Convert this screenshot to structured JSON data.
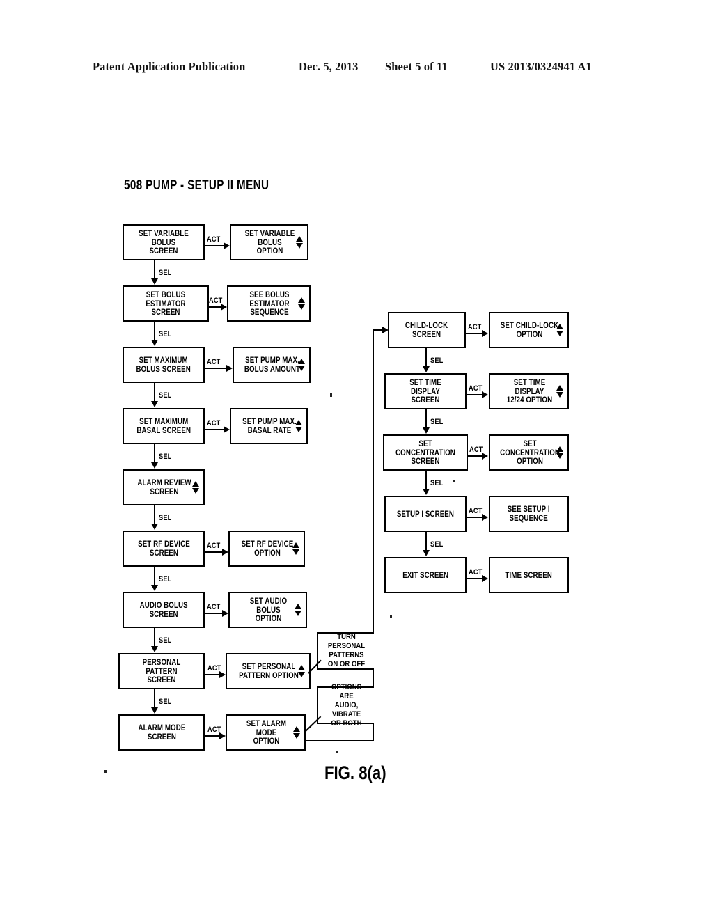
{
  "header": {
    "title": "Patent Application Publication",
    "date": "Dec. 5, 2013",
    "sheet": "Sheet 5 of 11",
    "number": "US 2013/0324941 A1"
  },
  "figure": {
    "title": "508 PUMP - SETUP II MENU",
    "caption": "FIG. 8(a)",
    "edge_label_act": "ACT",
    "edge_label_sel": "SEL"
  },
  "left_column": {
    "screens": [
      {
        "id": "set-variable-bolus-screen",
        "label": "SET VARIABLE BOLUS\nSCREEN",
        "arrows": false
      },
      {
        "id": "set-bolus-estimator-screen",
        "label": "SET BOLUS\nESTIMATOR SCREEN",
        "arrows": false
      },
      {
        "id": "set-maximum-bolus-screen",
        "label": "SET MAXIMUM\nBOLUS SCREEN",
        "arrows": false
      },
      {
        "id": "set-maximum-basal-screen",
        "label": "SET MAXIMUM\nBASAL SCREEN",
        "arrows": false
      },
      {
        "id": "alarm-review-screen",
        "label": "ALARM REVIEW\nSCREEN",
        "arrows": true
      },
      {
        "id": "set-rf-device-screen",
        "label": "SET RF DEVICE\nSCREEN",
        "arrows": false
      },
      {
        "id": "audio-bolus-screen",
        "label": "AUDIO BOLUS\nSCREEN",
        "arrows": false
      },
      {
        "id": "personal-pattern-screen",
        "label": "PERSONAL PATTERN\nSCREEN",
        "arrows": false
      },
      {
        "id": "alarm-mode-screen",
        "label": "ALARM MODE\nSCREEN",
        "arrows": false
      }
    ],
    "options": [
      {
        "id": "set-variable-bolus-option",
        "label": "SET VARIABLE BOLUS\nOPTION",
        "arrows": true
      },
      {
        "id": "see-bolus-estimator-sequence",
        "label": "SEE BOLUS ESTIMATOR\nSEQUENCE",
        "arrows": true
      },
      {
        "id": "set-pump-max-bolus-amount",
        "label": "SET PUMP MAX.\nBOLUS AMOUNT",
        "arrows": true
      },
      {
        "id": "set-pump-max-basal-rate",
        "label": "SET PUMP MAX.\nBASAL RATE",
        "arrows": true
      },
      {
        "id": "set-rf-device-option",
        "label": "SET RF DEVICE\nOPTION",
        "arrows": true
      },
      {
        "id": "set-audio-bolus-option",
        "label": "SET AUDIO BOLUS\nOPTION",
        "arrows": true
      },
      {
        "id": "set-personal-pattern-option",
        "label": "SET PERSONAL\nPATTERN OPTION",
        "arrows": true
      },
      {
        "id": "set-alarm-mode-option",
        "label": "SET ALARM MODE\nOPTION",
        "arrows": true
      }
    ]
  },
  "right_column": {
    "screens": [
      {
        "id": "child-lock-screen",
        "label": "CHILD-LOCK\nSCREEN",
        "arrows": false
      },
      {
        "id": "set-time-display-screen",
        "label": "SET TIME DISPLAY\nSCREEN",
        "arrows": false
      },
      {
        "id": "set-concentration-screen",
        "label": "SET CONCENTRATION\nSCREEN",
        "arrows": false
      },
      {
        "id": "setup-i-screen",
        "label": "SETUP I SCREEN",
        "arrows": false
      },
      {
        "id": "exit-screen",
        "label": "EXIT SCREEN",
        "arrows": false
      }
    ],
    "options": [
      {
        "id": "set-child-lock-option",
        "label": "SET CHILD-LOCK\nOPTION",
        "arrows": true
      },
      {
        "id": "set-time-display-option",
        "label": "SET TIME DISPLAY\n12/24 OPTION",
        "arrows": true
      },
      {
        "id": "set-concentration-option",
        "label": "SET CONCENTRATION\nOPTION",
        "arrows": true
      },
      {
        "id": "see-setup-i-sequence",
        "label": "SEE SETUP I\nSEQUENCE",
        "arrows": false
      },
      {
        "id": "time-screen",
        "label": "TIME SCREEN",
        "arrows": false
      }
    ]
  },
  "callouts": [
    {
      "id": "callout-personal-patterns",
      "label": "TURN PERSONAL\nPATTERNS\nON OR OFF"
    },
    {
      "id": "callout-alarm-options",
      "label": "OPTIONS ARE\nAUDIO, VIBRATE\nOR BOTH"
    }
  ],
  "colors": {
    "ink": "#000000",
    "paper": "#ffffff"
  }
}
